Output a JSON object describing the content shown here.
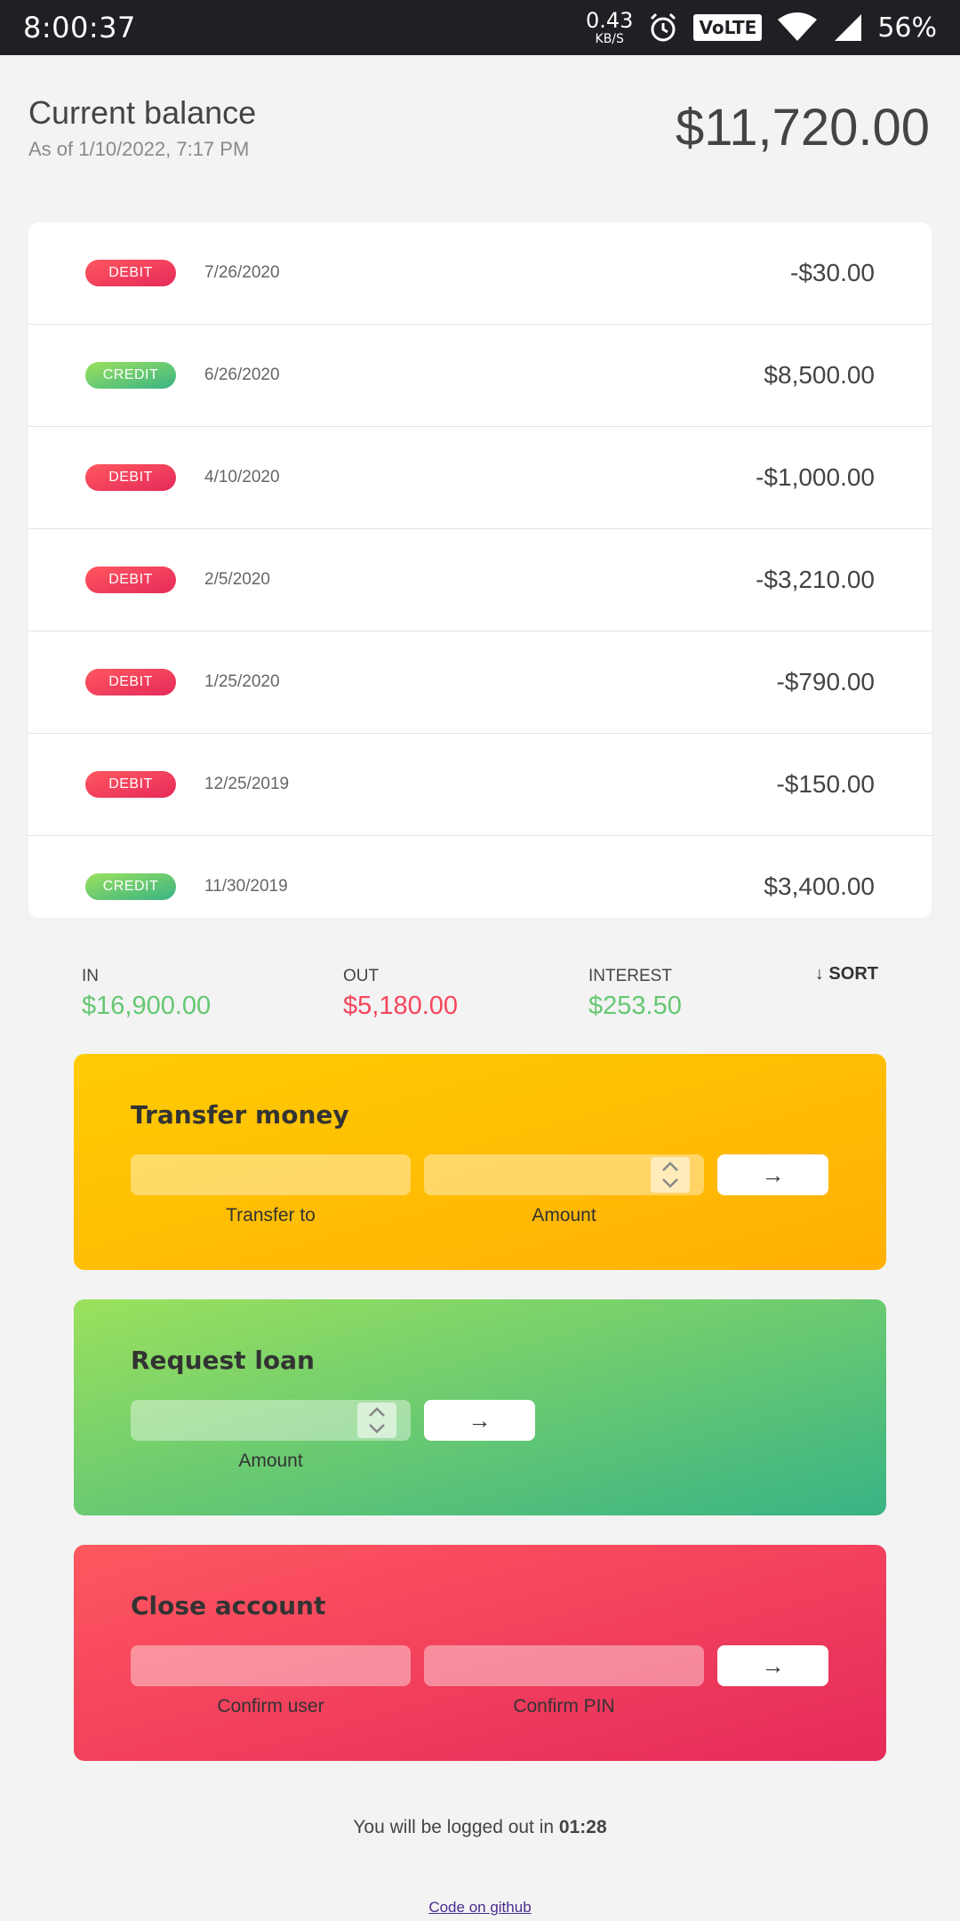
{
  "status_bar": {
    "time": "8:00:37",
    "speed_value": "0.43",
    "speed_unit": "KB/S",
    "volte": "VoLTE",
    "battery": "56%"
  },
  "balance": {
    "title": "Current balance",
    "date": "As of 1/10/2022, 7:17 PM",
    "value": "$11,720.00"
  },
  "movements": [
    {
      "type": "DEBIT",
      "date": "7/26/2020",
      "amount": "-$30.00"
    },
    {
      "type": "CREDIT",
      "date": "6/26/2020",
      "amount": "$8,500.00"
    },
    {
      "type": "DEBIT",
      "date": "4/10/2020",
      "amount": "-$1,000.00"
    },
    {
      "type": "DEBIT",
      "date": "2/5/2020",
      "amount": "-$3,210.00"
    },
    {
      "type": "DEBIT",
      "date": "1/25/2020",
      "amount": "-$790.00"
    },
    {
      "type": "DEBIT",
      "date": "12/25/2019",
      "amount": "-$150.00"
    },
    {
      "type": "CREDIT",
      "date": "11/30/2019",
      "amount": "$3,400.00"
    }
  ],
  "summary": {
    "in_label": "IN",
    "in_value": "$16,900.00",
    "out_label": "OUT",
    "out_value": "$5,180.00",
    "interest_label": "INTEREST",
    "interest_value": "$253.50",
    "sort_label": "↓ SORT",
    "positive_color": "#66c873",
    "negative_color": "#f5465d"
  },
  "transfer": {
    "title": "Transfer money",
    "to_label": "Transfer to",
    "amount_label": "Amount",
    "button": "→"
  },
  "loan": {
    "title": "Request loan",
    "amount_label": "Amount",
    "button": "→"
  },
  "close": {
    "title": "Close account",
    "user_label": "Confirm user",
    "pin_label": "Confirm PIN",
    "button": "→"
  },
  "footer": {
    "logout_text": "You will be logged out in ",
    "timer": "01:28",
    "github_link": "Code on github"
  }
}
